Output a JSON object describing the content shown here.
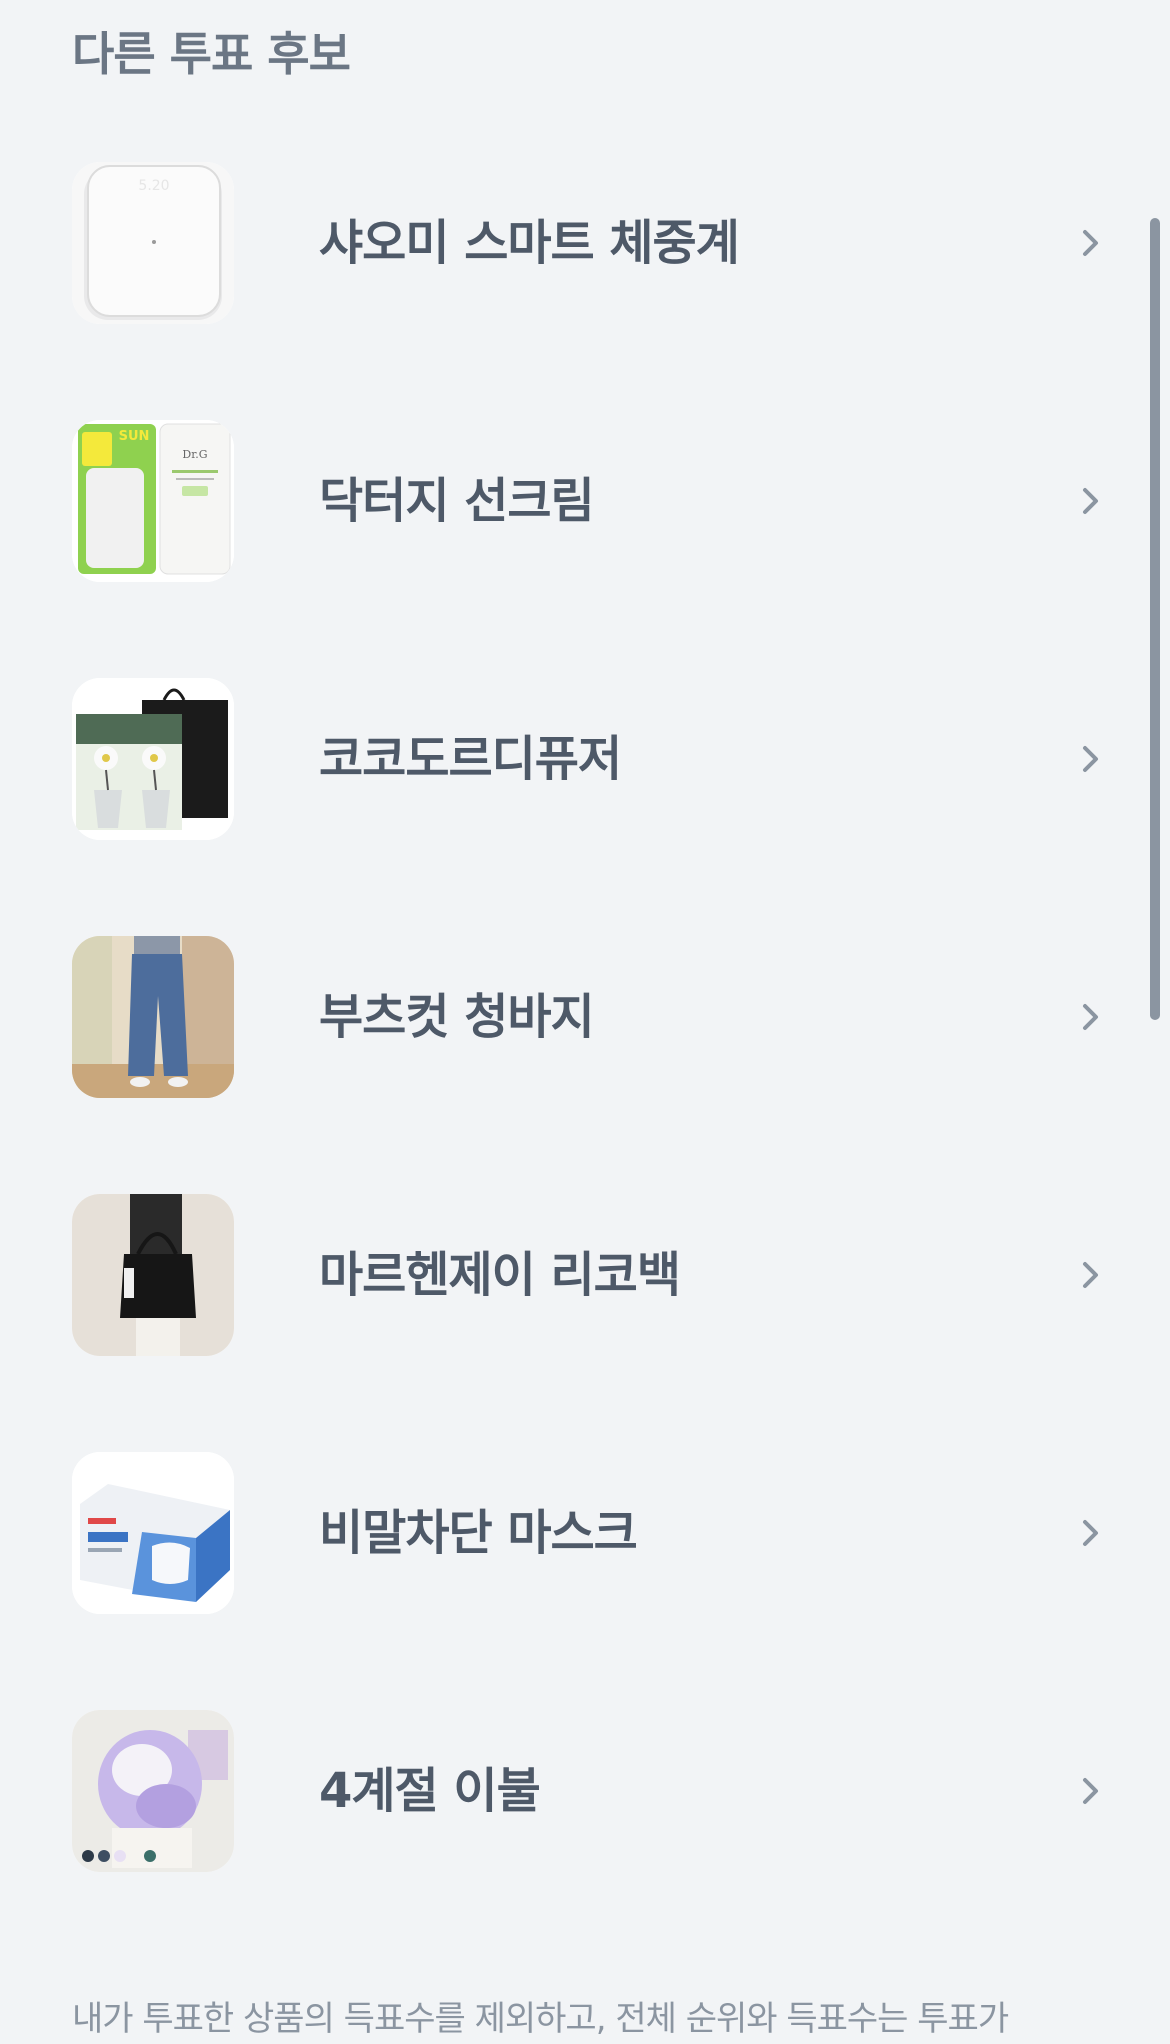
{
  "section": {
    "title": "다른 투표 후보"
  },
  "candidates": [
    {
      "name": "샤오미 스마트 체중계",
      "icon": "chevron-right-icon"
    },
    {
      "name": "닥터지 선크림",
      "icon": "chevron-right-icon"
    },
    {
      "name": "코코도르디퓨저",
      "icon": "chevron-right-icon"
    },
    {
      "name": "부츠컷 청바지",
      "icon": "chevron-right-icon"
    },
    {
      "name": "마르헨제이 리코백",
      "icon": "chevron-right-icon"
    },
    {
      "name": "비말차단 마스크",
      "icon": "chevron-right-icon"
    },
    {
      "name": "4계절 이불",
      "icon": "chevron-right-icon"
    }
  ],
  "footer": {
    "note": "내가 투표한 상품의 득표수를 제외하고, 전체 순위와 득표수는 투표가"
  },
  "colors": {
    "background": "#f2f4f6",
    "title": "#6b7684",
    "label": "#4e5968",
    "chevron": "#8b95a1"
  }
}
